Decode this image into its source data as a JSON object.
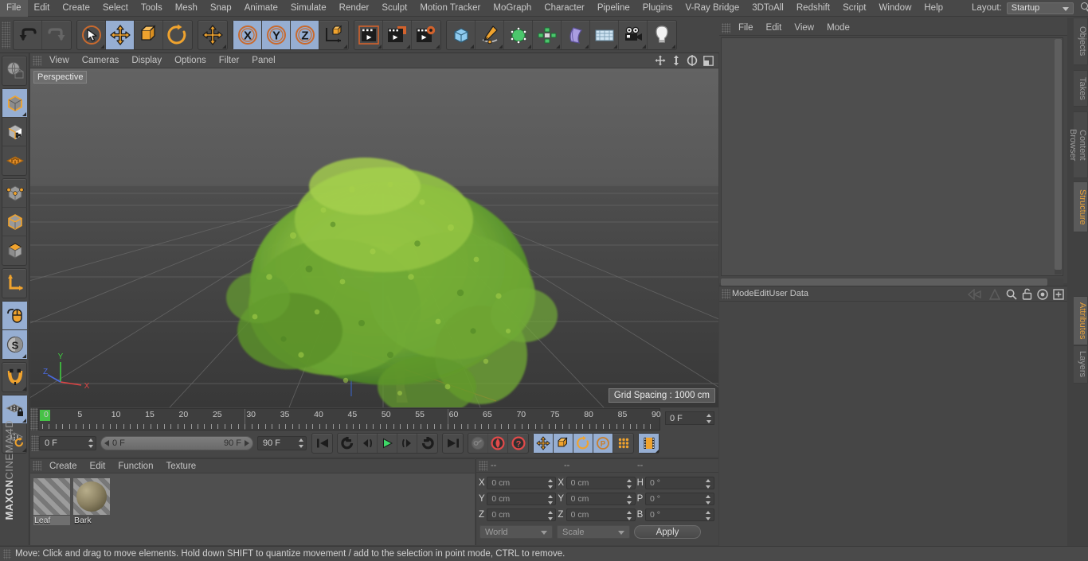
{
  "app": {
    "title": "CINEMA 4D",
    "brand_maxon": "MAXON",
    "brand_c4d": "CINEMA 4D"
  },
  "menubar": {
    "items": [
      {
        "label": "File"
      },
      {
        "label": "Edit"
      },
      {
        "label": "Create"
      },
      {
        "label": "Select"
      },
      {
        "label": "Tools"
      },
      {
        "label": "Mesh"
      },
      {
        "label": "Snap"
      },
      {
        "label": "Animate"
      },
      {
        "label": "Simulate"
      },
      {
        "label": "Render"
      },
      {
        "label": "Sculpt"
      },
      {
        "label": "Motion Tracker"
      },
      {
        "label": "MoGraph"
      },
      {
        "label": "Character"
      },
      {
        "label": "Pipeline"
      },
      {
        "label": "Plugins"
      },
      {
        "label": "V-Ray Bridge"
      },
      {
        "label": "3DToAll"
      },
      {
        "label": "Redshift"
      },
      {
        "label": "Script"
      },
      {
        "label": "Window"
      },
      {
        "label": "Help"
      }
    ],
    "layout_label": "Layout:",
    "layout_value": "Startup",
    "search_icon": "magnifier-icon"
  },
  "toolbar": {
    "groups": [
      {
        "name": "undo-redo",
        "buttons": [
          {
            "name": "undo-button",
            "icon": "undo-arrow-icon",
            "active": false,
            "disabled": false
          },
          {
            "name": "redo-button",
            "icon": "redo-arrow-icon",
            "active": false,
            "disabled": true
          }
        ]
      },
      {
        "name": "transform-tools",
        "buttons": [
          {
            "name": "live-selection-tool",
            "icon": "cursor-circle-icon",
            "active": false,
            "disabled": false
          },
          {
            "name": "move-tool",
            "icon": "move-arrows-icon",
            "active": true,
            "disabled": false
          },
          {
            "name": "scale-tool",
            "icon": "scale-box-icon",
            "active": false,
            "disabled": false
          },
          {
            "name": "rotate-tool",
            "icon": "rotate-circle-icon",
            "active": false,
            "disabled": false
          }
        ]
      },
      {
        "name": "extra-move",
        "buttons": [
          {
            "name": "move-duplicate-tool",
            "icon": "move-arrows-icon",
            "active": false,
            "disabled": false
          }
        ]
      },
      {
        "name": "axis-locks",
        "buttons": [
          {
            "name": "lock-x-axis",
            "icon": "x-axis-icon",
            "active": true,
            "disabled": false
          },
          {
            "name": "lock-y-axis",
            "icon": "y-axis-icon",
            "active": true,
            "disabled": false
          },
          {
            "name": "lock-z-axis",
            "icon": "z-axis-icon",
            "active": true,
            "disabled": false
          },
          {
            "name": "world-object-axis",
            "icon": "axis-cube-icon",
            "active": false,
            "disabled": false
          }
        ]
      },
      {
        "name": "render-tools",
        "buttons": [
          {
            "name": "render-view-button",
            "icon": "clapper-view-icon",
            "active": false,
            "disabled": false
          },
          {
            "name": "render-to-picture-viewer-button",
            "icon": "clapper-picture-icon",
            "active": false,
            "disabled": false
          },
          {
            "name": "render-settings-button",
            "icon": "clapper-gear-icon",
            "active": false,
            "disabled": false
          }
        ]
      },
      {
        "name": "create-objects",
        "buttons": [
          {
            "name": "add-cube-button",
            "icon": "blue-cube-icon",
            "active": false,
            "disabled": false
          },
          {
            "name": "add-spline-button",
            "icon": "pen-spline-icon",
            "active": false,
            "disabled": false
          },
          {
            "name": "add-nurbs-button",
            "icon": "green-nurbs-icon",
            "active": false,
            "disabled": false
          },
          {
            "name": "add-array-button",
            "icon": "green-array-icon",
            "active": false,
            "disabled": false
          },
          {
            "name": "add-deformer-button",
            "icon": "purple-bend-icon",
            "active": false,
            "disabled": false
          },
          {
            "name": "add-environment-button",
            "icon": "floor-grid-icon",
            "active": false,
            "disabled": false
          },
          {
            "name": "add-camera-button",
            "icon": "camera-icon",
            "active": false,
            "disabled": false
          },
          {
            "name": "add-light-button",
            "icon": "light-bulb-icon",
            "active": false,
            "disabled": false
          }
        ]
      }
    ]
  },
  "left_toolbar": {
    "groups": [
      {
        "buttons": [
          {
            "name": "undo-view-button",
            "icon": "globe-view-icon",
            "active": false
          }
        ]
      },
      {
        "buttons": [
          {
            "name": "model-mode-button",
            "icon": "model-cube-icon",
            "active": true
          },
          {
            "name": "texture-mode-button",
            "icon": "texture-cube-icon",
            "active": false
          },
          {
            "name": "workplane-mode-button",
            "icon": "workplane-grid-icon",
            "active": false
          }
        ]
      },
      {
        "buttons": [
          {
            "name": "points-mode-button",
            "icon": "points-cube-icon",
            "active": false
          },
          {
            "name": "edges-mode-button",
            "icon": "edges-cube-icon",
            "active": false
          },
          {
            "name": "polygons-mode-button",
            "icon": "polygons-cube-icon",
            "active": false
          }
        ]
      },
      {
        "buttons": [
          {
            "name": "axis-mode-button",
            "icon": "axis-l-icon",
            "active": false
          }
        ]
      },
      {
        "buttons": [
          {
            "name": "viewport-solo-button",
            "icon": "mouse-icon",
            "active": true
          },
          {
            "name": "enable-snap-button",
            "icon": "snap-s-icon",
            "active": true
          }
        ]
      },
      {
        "buttons": [
          {
            "name": "magnet-tool-button",
            "icon": "magnet-icon",
            "active": false
          }
        ]
      },
      {
        "buttons": [
          {
            "name": "lock-workplane-button",
            "icon": "workplane-lock-icon",
            "active": true
          },
          {
            "name": "planar-workplane-button",
            "icon": "workplane-rotate-icon",
            "active": false
          }
        ]
      }
    ]
  },
  "viewport": {
    "menu": [
      {
        "label": "View"
      },
      {
        "label": "Cameras"
      },
      {
        "label": "Display"
      },
      {
        "label": "Options"
      },
      {
        "label": "Filter"
      },
      {
        "label": "Panel"
      }
    ],
    "camera_label": "Perspective",
    "grid_spacing": "Grid Spacing : 1000 cm",
    "axis_gizmo": {
      "x": "X",
      "y": "Y",
      "z": "Z",
      "x_color": "#e04a4a",
      "y_color": "#4ad44a",
      "z_color": "#4a6ae0"
    },
    "nav_icons": [
      {
        "name": "pan-view-icon"
      },
      {
        "name": "dolly-view-icon"
      },
      {
        "name": "orbit-view-icon"
      },
      {
        "name": "maximize-view-icon"
      }
    ],
    "scene_object": "tree"
  },
  "timeline": {
    "ticks": [
      {
        "label": "0",
        "value": 0
      },
      {
        "label": "5",
        "value": 5
      },
      {
        "label": "10",
        "value": 10
      },
      {
        "label": "15",
        "value": 15
      },
      {
        "label": "20",
        "value": 20
      },
      {
        "label": "25",
        "value": 25
      },
      {
        "label": "30",
        "value": 30
      },
      {
        "label": "35",
        "value": 35
      },
      {
        "label": "40",
        "value": 40
      },
      {
        "label": "45",
        "value": 45
      },
      {
        "label": "50",
        "value": 50
      },
      {
        "label": "55",
        "value": 55
      },
      {
        "label": "60",
        "value": 60
      },
      {
        "label": "65",
        "value": 65
      },
      {
        "label": "70",
        "value": 70
      },
      {
        "label": "75",
        "value": 75
      },
      {
        "label": "80",
        "value": 80
      },
      {
        "label": "85",
        "value": 85
      },
      {
        "label": "90",
        "value": 90
      }
    ],
    "current_frame_display": "0 F",
    "current_frame_field": "0 F",
    "range_start": "0 F",
    "range_end": "90 F",
    "max_frame": "90 F",
    "transport": [
      {
        "name": "go-to-start-button",
        "icon": "skip-start-icon"
      },
      {
        "name": "play-backwards-loop-button",
        "icon": "loop-back-icon"
      },
      {
        "name": "previous-frame-button",
        "icon": "step-back-icon"
      },
      {
        "name": "play-forward-button",
        "icon": "play-icon"
      },
      {
        "name": "next-frame-button",
        "icon": "step-forward-icon"
      },
      {
        "name": "play-loop-button",
        "icon": "loop-forward-icon"
      },
      {
        "name": "go-to-end-button",
        "icon": "skip-end-icon"
      }
    ],
    "record_tools": [
      {
        "name": "record-active-objects-button",
        "icon": "key-icon",
        "disabled": true
      },
      {
        "name": "autokeying-button",
        "icon": "red-circle-icon",
        "disabled": false
      },
      {
        "name": "keyframe-selection-button",
        "icon": "red-question-icon",
        "disabled": false
      }
    ],
    "key_toggles": [
      {
        "name": "position-key-toggle",
        "icon": "move-arrows-icon",
        "active": true
      },
      {
        "name": "scale-key-toggle",
        "icon": "scale-box-icon",
        "active": true
      },
      {
        "name": "rotation-key-toggle",
        "icon": "rotate-circle-icon",
        "active": true
      },
      {
        "name": "parameter-key-toggle",
        "icon": "p-circle-icon",
        "active": true
      },
      {
        "name": "point-level-animation-toggle",
        "icon": "pla-dots-icon",
        "active": false
      }
    ],
    "timeline_mode_button": {
      "name": "keyframe-mode-button",
      "icon": "film-strip-icon",
      "active": true
    }
  },
  "material_manager": {
    "menu": [
      {
        "label": "Create"
      },
      {
        "label": "Edit"
      },
      {
        "label": "Function"
      },
      {
        "label": "Texture"
      }
    ],
    "materials": [
      {
        "name": "Leaf",
        "color": "#8fa05a",
        "selected": true
      },
      {
        "name": "Bark",
        "color": "#8b8162",
        "selected": false
      }
    ]
  },
  "coordinates": {
    "headers": [
      "--",
      "--",
      "--"
    ],
    "rows": [
      {
        "pos_label": "X",
        "pos_value": "0 cm",
        "size_label": "X",
        "size_value": "0 cm",
        "rot_label": "H",
        "rot_value": "0 °"
      },
      {
        "pos_label": "Y",
        "pos_value": "0 cm",
        "size_label": "Y",
        "size_value": "0 cm",
        "rot_label": "P",
        "rot_value": "0 °"
      },
      {
        "pos_label": "Z",
        "pos_value": "0 cm",
        "size_label": "Z",
        "size_value": "0 cm",
        "rot_label": "B",
        "rot_value": "0 °"
      }
    ],
    "system_dropdown": "World",
    "mode_dropdown": "Scale",
    "apply_label": "Apply"
  },
  "object_manager": {
    "menu": [
      {
        "label": "File"
      },
      {
        "label": "Edit"
      },
      {
        "label": "View"
      },
      {
        "label": "Mode"
      }
    ],
    "items": []
  },
  "attributes_manager": {
    "menu": [
      {
        "label": "Mode"
      },
      {
        "label": "Edit"
      },
      {
        "label": "User Data"
      }
    ],
    "icons": [
      {
        "name": "interpolation-left-icon"
      },
      {
        "name": "interpolation-right-icon"
      },
      {
        "name": "search-icon"
      },
      {
        "name": "unlock-icon"
      },
      {
        "name": "target-icon"
      },
      {
        "name": "add-tab-icon"
      }
    ]
  },
  "right_tabs": [
    {
      "label": "Objects",
      "active": false
    },
    {
      "label": "Takes",
      "active": false
    },
    {
      "label": "Content Browser",
      "active": false
    },
    {
      "label": "Structure",
      "active": true
    },
    {
      "label": "Attributes",
      "active": true
    },
    {
      "label": "Layers",
      "active": false
    }
  ],
  "statusbar": {
    "message": "Move: Click and drag to move elements. Hold down SHIFT to quantize movement / add to the selection in point mode, CTRL to remove."
  },
  "colors": {
    "bg": "#414141",
    "panel": "#464646",
    "active_blue": "#96aed2",
    "accent_orange": "#e8a33d",
    "viewport_top": "#5b5b5b",
    "viewport_bottom": "#3d3d3d"
  }
}
